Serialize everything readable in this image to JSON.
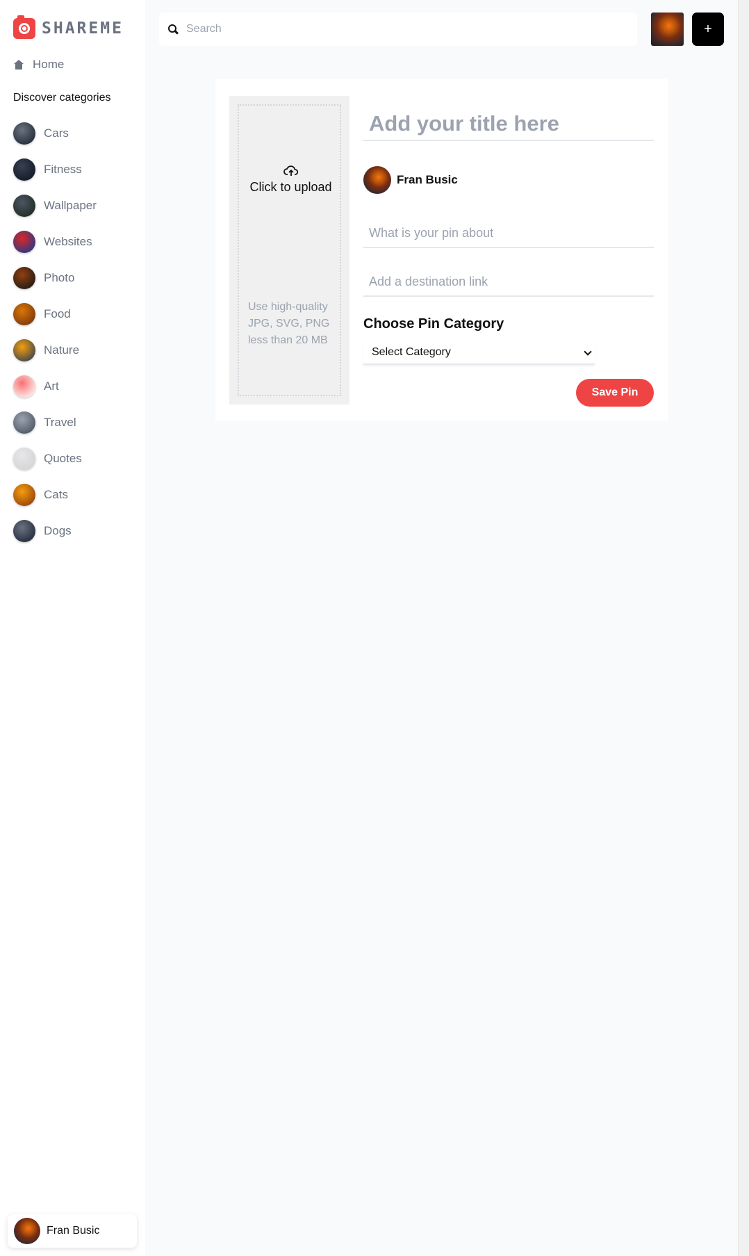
{
  "app": {
    "name": "SHAREME"
  },
  "sidebar": {
    "home_label": "Home",
    "discover_title": "Discover categories",
    "categories": [
      {
        "label": "Cars",
        "thumb": [
          "#6b7280",
          "#1f2937"
        ]
      },
      {
        "label": "Fitness",
        "thumb": [
          "#374151",
          "#111827"
        ]
      },
      {
        "label": "Wallpaper",
        "thumb": [
          "#4b5563",
          "#1f2a20"
        ]
      },
      {
        "label": "Websites",
        "thumb": [
          "#dc2626",
          "#1e3a8a"
        ]
      },
      {
        "label": "Photo",
        "thumb": [
          "#92400e",
          "#1c1917"
        ]
      },
      {
        "label": "Food",
        "thumb": [
          "#d97706",
          "#78350f"
        ]
      },
      {
        "label": "Nature",
        "thumb": [
          "#f59e0b",
          "#374151"
        ]
      },
      {
        "label": "Art",
        "thumb": [
          "#f87171",
          "#fef2f2"
        ]
      },
      {
        "label": "Travel",
        "thumb": [
          "#9ca3af",
          "#4b5563"
        ]
      },
      {
        "label": "Quotes",
        "thumb": [
          "#e5e7eb",
          "#d6d3d1"
        ]
      },
      {
        "label": "Cats",
        "thumb": [
          "#f59e0b",
          "#92400e"
        ]
      },
      {
        "label": "Dogs",
        "thumb": [
          "#6b7280",
          "#1e293b"
        ]
      }
    ],
    "user_name": "Fran Busic"
  },
  "header": {
    "search_placeholder": "Search",
    "add_button_label": "+"
  },
  "create_pin": {
    "upload_label": "Click to upload",
    "upload_hint": "Use high-quality JPG, SVG, PNG less than 20 MB",
    "title_placeholder": "Add your title here",
    "author_name": "Fran Busic",
    "about_placeholder": "What is your pin about",
    "link_placeholder": "Add a destination link",
    "category_heading": "Choose Pin Category",
    "category_selected": "Select Category",
    "save_label": "Save Pin"
  },
  "colors": {
    "accent": "#ef4444",
    "muted_text": "#6b7280",
    "placeholder": "#9ca3af"
  }
}
